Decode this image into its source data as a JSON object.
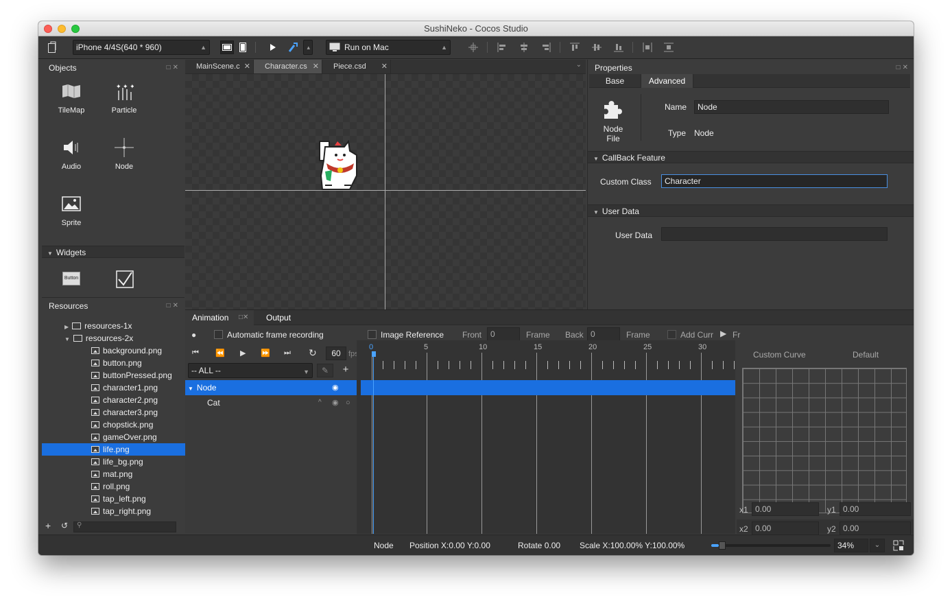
{
  "window": {
    "title": "SushiNeko - Cocos Studio"
  },
  "toolbar": {
    "device": "iPhone 4/4S(640 * 960)",
    "run_target": "Run on Mac"
  },
  "objects": {
    "title": "Objects",
    "items": [
      {
        "label": "TileMap",
        "icon": "tilemap-icon"
      },
      {
        "label": "Particle",
        "icon": "particle-icon"
      },
      {
        "label": "Audio",
        "icon": "audio-icon"
      },
      {
        "label": "Node",
        "icon": "node-icon"
      },
      {
        "label": "Sprite",
        "icon": "sprite-icon"
      }
    ],
    "widgets_title": "Widgets",
    "widget_button_text": "Button"
  },
  "resources": {
    "title": "Resources",
    "folders": [
      "resources-1x",
      "resources-2x"
    ],
    "files": [
      "background.png",
      "button.png",
      "buttonPressed.png",
      "character1.png",
      "character2.png",
      "character3.png",
      "chopstick.png",
      "gameOver.png",
      "life.png",
      "life_bg.png",
      "mat.png",
      "roll.png",
      "tap_left.png",
      "tap_right.png"
    ],
    "selected": "life.png"
  },
  "editor_tabs": [
    "MainScene.c",
    "Character.cs",
    "Piece.csd"
  ],
  "properties": {
    "title": "Properties",
    "tabs": [
      "Base",
      "Advanced"
    ],
    "node_file_label": "Node\nFile",
    "name_label": "Name",
    "name_value": "Node",
    "type_label": "Type",
    "type_value": "Node",
    "callback_section": "CallBack Feature",
    "custom_class_label": "Custom Class",
    "custom_class_value": "Character",
    "user_data_section": "User Data",
    "user_data_label": "User Data",
    "user_data_value": ""
  },
  "animation": {
    "tabs": [
      "Animation",
      "Output"
    ],
    "auto_record": "Automatic frame recording",
    "image_reference": "Image Reference",
    "front_label": "Front",
    "front_value": "0",
    "frame_label": "Frame",
    "back_label": "Back",
    "back_value": "0",
    "frame_label2": "Frame",
    "add_curve": "Add Curr",
    "fr_label": "Fr",
    "fps_value": "60",
    "fps_unit": "fps",
    "filter": "-- ALL --",
    "timeline_numbers": [
      "0",
      "5",
      "10",
      "15",
      "20",
      "25",
      "30"
    ],
    "tracks": [
      {
        "name": "Node"
      },
      {
        "name": "Cat"
      }
    ],
    "custom_curve": "Custom Curve",
    "default_label": "Default",
    "x1_label": "x1",
    "x1": "0.00",
    "y1_label": "y1",
    "y1": "0.00",
    "x2_label": "x2",
    "x2": "0.00",
    "y2_label": "y2",
    "y2": "0.00"
  },
  "status": {
    "node": "Node",
    "position": "Position X:0.00  Y:0.00",
    "rotate": "Rotate 0.00",
    "scale": "Scale X:100.00%  Y:100.00%",
    "zoom": "34%",
    "zoom_level": 0.34
  },
  "colors": {
    "accent": "#1a6fe0",
    "panel": "#3c3c3c"
  }
}
